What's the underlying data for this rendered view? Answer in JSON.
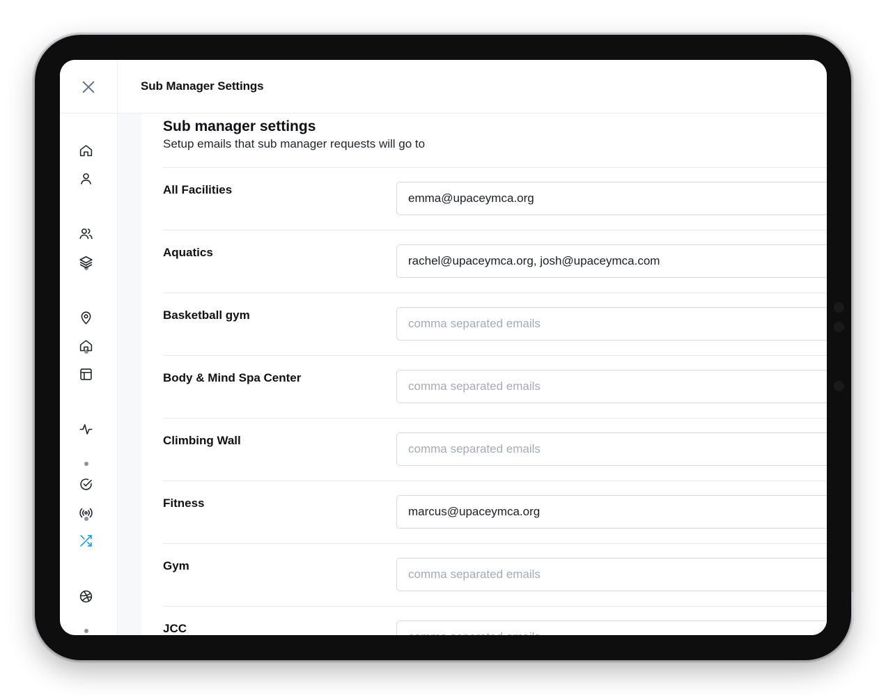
{
  "header": {
    "title": "Sub Manager Settings"
  },
  "section": {
    "title": "Sub manager settings",
    "subtitle": "Setup emails that sub manager requests will go to"
  },
  "placeholder": "comma separated emails",
  "rows": [
    {
      "label": "All Facilities",
      "value": "emma@upaceymca.org"
    },
    {
      "label": "Aquatics",
      "value": "rachel@upaceymca.org, josh@upaceymca.com"
    },
    {
      "label": "Basketball gym",
      "value": ""
    },
    {
      "label": "Body & Mind Spa Center",
      "value": ""
    },
    {
      "label": "Climbing Wall",
      "value": ""
    },
    {
      "label": "Fitness",
      "value": "marcus@upaceymca.org"
    },
    {
      "label": "Gym",
      "value": ""
    },
    {
      "label": "JCC",
      "value": ""
    }
  ],
  "sidebar": {
    "icons": [
      "home-icon",
      "user-icon",
      "users-icon",
      "layers-icon",
      "map-pin-icon",
      "building-icon",
      "layout-icon",
      "activity-icon",
      "check-circle-icon",
      "broadcast-icon",
      "shuffle-icon",
      "dribbble-icon"
    ],
    "active_icon": "shuffle-icon"
  },
  "colors": {
    "accent": "#1e9ad6",
    "icon": "#1f2329",
    "dot": "#8b929c"
  }
}
